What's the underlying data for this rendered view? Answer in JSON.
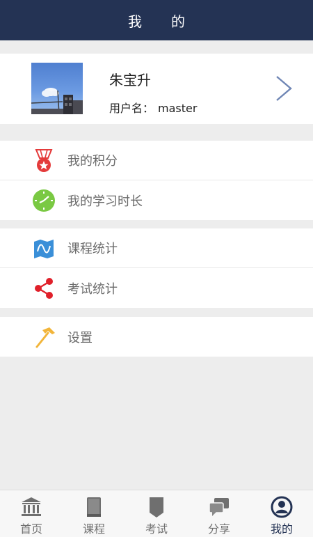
{
  "header": {
    "title": "我的"
  },
  "profile": {
    "name": "朱宝升",
    "username_label": "用户名：",
    "username": "master"
  },
  "menu": {
    "groups": [
      {
        "items": [
          {
            "label": "我的积分",
            "icon": "medal-icon"
          },
          {
            "label": "我的学习时长",
            "icon": "clock-icon"
          }
        ]
      },
      {
        "items": [
          {
            "label": "课程统计",
            "icon": "map-wave-icon"
          },
          {
            "label": "考试统计",
            "icon": "share-nodes-icon"
          }
        ]
      },
      {
        "items": [
          {
            "label": "设置",
            "icon": "hammer-icon"
          }
        ]
      }
    ]
  },
  "tabbar": {
    "tabs": [
      {
        "label": "首页",
        "icon": "bank-icon",
        "active": false
      },
      {
        "label": "课程",
        "icon": "book-icon",
        "active": false
      },
      {
        "label": "考试",
        "icon": "bookmark-icon",
        "active": false
      },
      {
        "label": "分享",
        "icon": "chat-bubbles-icon",
        "active": false
      },
      {
        "label": "我的",
        "icon": "user-circle-icon",
        "active": true
      }
    ]
  },
  "colors": {
    "header_bg": "#243354",
    "accent": "#243354",
    "medal_red": "#e43b3b",
    "clock_green": "#7ac943",
    "map_blue": "#3a8fd8",
    "share_red": "#e0202a",
    "hammer_yellow": "#f2b53a"
  }
}
